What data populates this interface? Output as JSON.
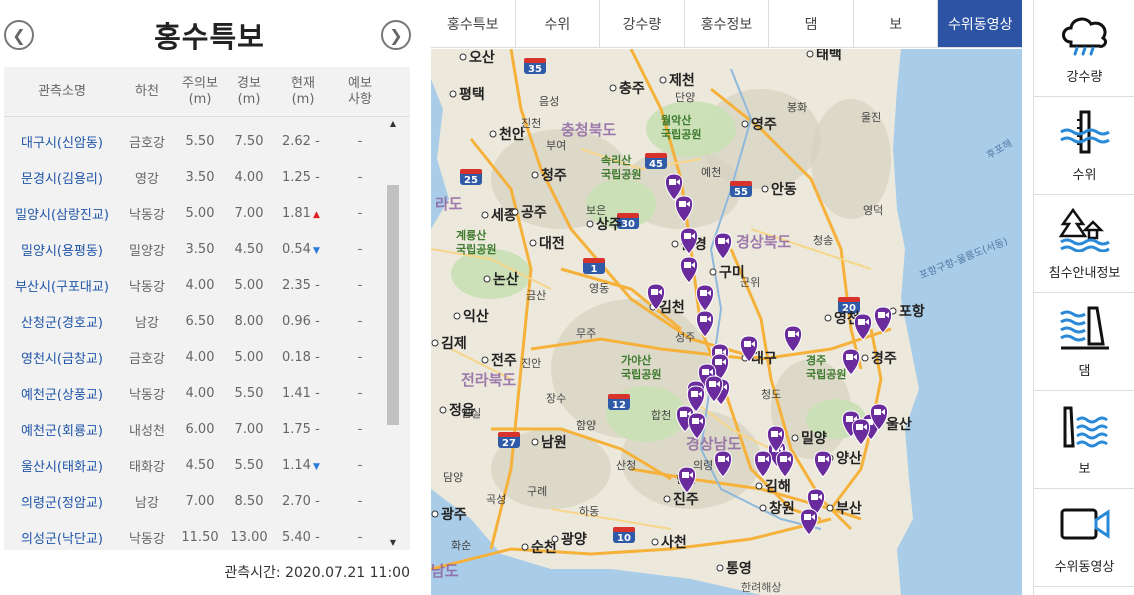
{
  "left": {
    "title": "홍수특보",
    "columns": [
      "관측소명",
      "하천",
      "주의보\n(m)",
      "경보\n(m)",
      "현재\n(m)",
      "예보\n사항"
    ],
    "rows": [
      {
        "name": "대구시(신암동)",
        "river": "금호강",
        "watch": "5.50",
        "warning": "7.50",
        "current": "2.62",
        "trend": "-",
        "forecast": "-"
      },
      {
        "name": "문경시(김용리)",
        "river": "영강",
        "watch": "3.50",
        "warning": "4.00",
        "current": "1.25",
        "trend": "-",
        "forecast": "-"
      },
      {
        "name": "밀양시(삼랑진교)",
        "river": "낙동강",
        "watch": "5.00",
        "warning": "7.00",
        "current": "1.81",
        "trend": "up",
        "forecast": "-"
      },
      {
        "name": "밀양시(용평동)",
        "river": "밀양강",
        "watch": "3.50",
        "warning": "4.50",
        "current": "0.54",
        "trend": "down",
        "forecast": "-"
      },
      {
        "name": "부산시(구포대교)",
        "river": "낙동강",
        "watch": "4.00",
        "warning": "5.00",
        "current": "2.35",
        "trend": "-",
        "forecast": "-"
      },
      {
        "name": "산청군(경호교)",
        "river": "남강",
        "watch": "6.50",
        "warning": "8.00",
        "current": "0.96",
        "trend": "-",
        "forecast": "-"
      },
      {
        "name": "영천시(금창교)",
        "river": "금호강",
        "watch": "4.00",
        "warning": "5.00",
        "current": "0.18",
        "trend": "-",
        "forecast": "-"
      },
      {
        "name": "예천군(상풍교)",
        "river": "낙동강",
        "watch": "4.00",
        "warning": "5.50",
        "current": "1.41",
        "trend": "-",
        "forecast": "-"
      },
      {
        "name": "예천군(회룡교)",
        "river": "내성천",
        "watch": "6.00",
        "warning": "7.00",
        "current": "1.75",
        "trend": "-",
        "forecast": "-"
      },
      {
        "name": "울산시(태화교)",
        "river": "태화강",
        "watch": "4.50",
        "warning": "5.50",
        "current": "1.14",
        "trend": "down",
        "forecast": "-"
      },
      {
        "name": "의령군(정암교)",
        "river": "남강",
        "watch": "7.00",
        "warning": "8.50",
        "current": "2.70",
        "trend": "-",
        "forecast": "-"
      },
      {
        "name": "의성군(낙단교)",
        "river": "낙동강",
        "watch": "11.50",
        "warning": "13.00",
        "current": "5.40",
        "trend": "-",
        "forecast": "-"
      }
    ],
    "observation_time": "관측시간: 2020.07.21 11:00"
  },
  "tabs": [
    {
      "label": "홍수특보",
      "active": false
    },
    {
      "label": "수위",
      "active": false
    },
    {
      "label": "강수량",
      "active": false
    },
    {
      "label": "홍수정보",
      "active": false
    },
    {
      "label": "댐",
      "active": false
    },
    {
      "label": "보",
      "active": false
    },
    {
      "label": "수위동영상",
      "active": true
    }
  ],
  "map": {
    "cities": [
      {
        "label": "오산"
      },
      {
        "label": "평택"
      },
      {
        "label": "천안"
      },
      {
        "label": "충주"
      },
      {
        "label": "제천"
      },
      {
        "label": "태백"
      },
      {
        "label": "영주"
      },
      {
        "label": "청주"
      },
      {
        "label": "세종"
      },
      {
        "label": "공주"
      },
      {
        "label": "대전"
      },
      {
        "label": "상주"
      },
      {
        "label": "안동"
      },
      {
        "label": "논산"
      },
      {
        "label": "구미"
      },
      {
        "label": "김천"
      },
      {
        "label": "익산"
      },
      {
        "label": "영천"
      },
      {
        "label": "포항"
      },
      {
        "label": "김제"
      },
      {
        "label": "전주"
      },
      {
        "label": "대구"
      },
      {
        "label": "경주"
      },
      {
        "label": "정읍"
      },
      {
        "label": "울산"
      },
      {
        "label": "남원"
      },
      {
        "label": "밀양"
      },
      {
        "label": "양산"
      },
      {
        "label": "김해"
      },
      {
        "label": "진주"
      },
      {
        "label": "창원"
      },
      {
        "label": "부산"
      },
      {
        "label": "광주"
      },
      {
        "label": "순천"
      },
      {
        "label": "광양"
      },
      {
        "label": "사천"
      },
      {
        "label": "통영"
      },
      {
        "label": "문경"
      }
    ],
    "towns": [
      {
        "label": "음성"
      },
      {
        "label": "단양"
      },
      {
        "label": "봉화"
      },
      {
        "label": "예천"
      },
      {
        "label": "진천"
      },
      {
        "label": "보은"
      },
      {
        "label": "청송"
      },
      {
        "label": "영덕"
      },
      {
        "label": "영동"
      },
      {
        "label": "군위"
      },
      {
        "label": "금산"
      },
      {
        "label": "무주"
      },
      {
        "label": "성주"
      },
      {
        "label": "진안"
      },
      {
        "label": "장수"
      },
      {
        "label": "합천"
      },
      {
        "label": "임실"
      },
      {
        "label": "함양"
      },
      {
        "label": "청도"
      },
      {
        "label": "산청"
      },
      {
        "label": "의령"
      },
      {
        "label": "함안"
      },
      {
        "label": "담양"
      },
      {
        "label": "곡성"
      },
      {
        "label": "구례"
      },
      {
        "label": "하동"
      },
      {
        "label": "화순"
      },
      {
        "label": "울진"
      },
      {
        "label": "부여"
      }
    ],
    "provinces": [
      {
        "label": "충청북도"
      },
      {
        "label": "경상북도"
      },
      {
        "label": "전라북도"
      },
      {
        "label": "경상남도"
      },
      {
        "label": "남도"
      },
      {
        "label": "라도"
      }
    ],
    "parks": [
      {
        "label": "월악산\n국립공원"
      },
      {
        "label": "속리산\n국립공원"
      },
      {
        "label": "계룡산\n국립공원"
      },
      {
        "label": "가야산\n국립공원"
      },
      {
        "label": "경주\n국립공원"
      }
    ],
    "highways": [
      {
        "label": "35"
      },
      {
        "label": "45"
      },
      {
        "label": "55"
      },
      {
        "label": "25"
      },
      {
        "label": "30"
      },
      {
        "label": "1"
      },
      {
        "label": "20"
      },
      {
        "label": "12"
      },
      {
        "label": "27"
      },
      {
        "label": "10"
      }
    ],
    "sea_label": "후포해",
    "ridge_label": "포항구항-울릉도(서동)",
    "copyright": "한려해상",
    "marker_count": 36,
    "marker_color": "#6a2c9c"
  },
  "sidebar": [
    {
      "label": "강수량",
      "icon": "rain-cloud-icon"
    },
    {
      "label": "수위",
      "icon": "water-level-gauge-icon"
    },
    {
      "label": "침수안내정보",
      "icon": "flood-info-icon"
    },
    {
      "label": "댐",
      "icon": "dam-icon"
    },
    {
      "label": "보",
      "icon": "weir-icon"
    },
    {
      "label": "수위동영상",
      "icon": "video-camera-icon"
    }
  ],
  "colors": {
    "accent": "#2d54a4",
    "station_link": "#1f55a8",
    "trend_up": "#e02020",
    "trend_down": "#2b7ad8"
  }
}
